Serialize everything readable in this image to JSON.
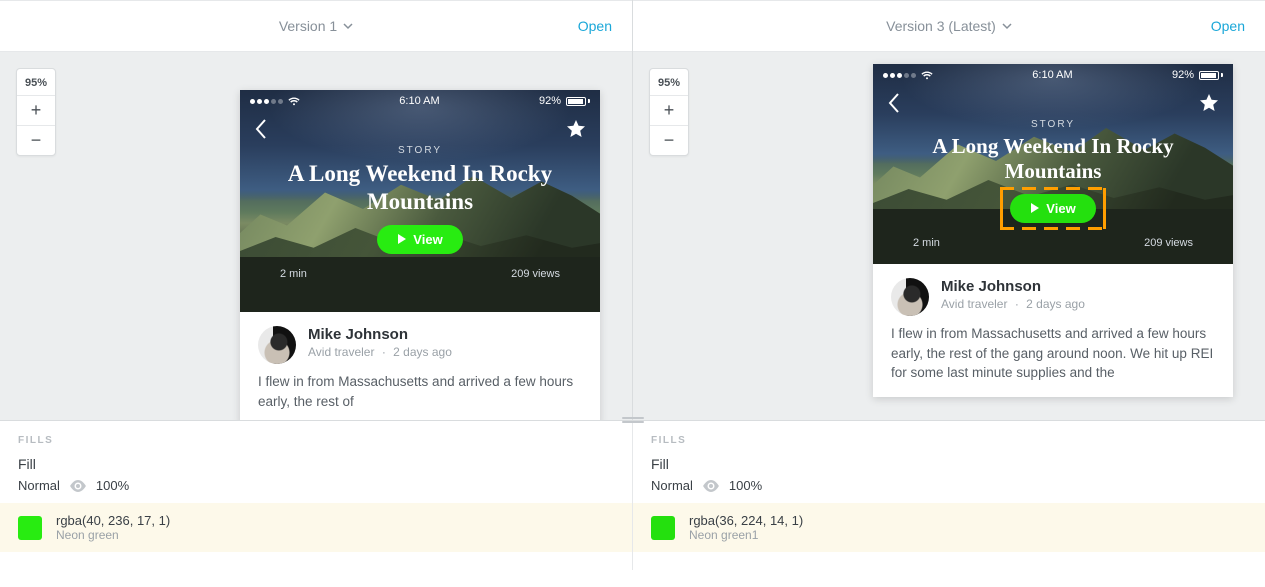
{
  "left": {
    "version_label": "Version 1",
    "open_label": "Open",
    "zoom": "95%",
    "mock": {
      "status": {
        "time": "6:10 AM",
        "battery": "92%"
      },
      "story_label": "STORY",
      "title": "A Long Weekend In Rocky Mountains",
      "view_label": "View",
      "duration": "2 min",
      "views": "209 views",
      "author": {
        "name": "Mike Johnson",
        "role": "Avid traveler",
        "when": "2 days ago"
      },
      "body": "I flew in from Massachusetts and arrived a few hours early, the rest of"
    },
    "fills": {
      "heading": "FILLS",
      "label": "Fill",
      "blend": "Normal",
      "opacity": "100%",
      "color_value": "rgba(40, 236, 17, 1)",
      "color_name": "Neon green",
      "swatch_hex": "#28ec11"
    }
  },
  "right": {
    "version_label": "Version 3 (Latest)",
    "open_label": "Open",
    "zoom": "95%",
    "mock": {
      "status": {
        "time": "6:10 AM",
        "battery": "92%"
      },
      "story_label": "STORY",
      "title": "A Long Weekend In Rocky Mountains",
      "view_label": "View",
      "duration": "2 min",
      "views": "209 views",
      "author": {
        "name": "Mike Johnson",
        "role": "Avid traveler",
        "when": "2 days ago"
      },
      "body": "I flew in from Massachusetts and arrived a few hours early, the rest of the gang around noon. We hit up REI for some last minute supplies and the"
    },
    "fills": {
      "heading": "FILLS",
      "label": "Fill",
      "blend": "Normal",
      "opacity": "100%",
      "color_value": "rgba(36, 224, 14, 1)",
      "color_name": "Neon green1",
      "swatch_hex": "#24e00e"
    }
  }
}
